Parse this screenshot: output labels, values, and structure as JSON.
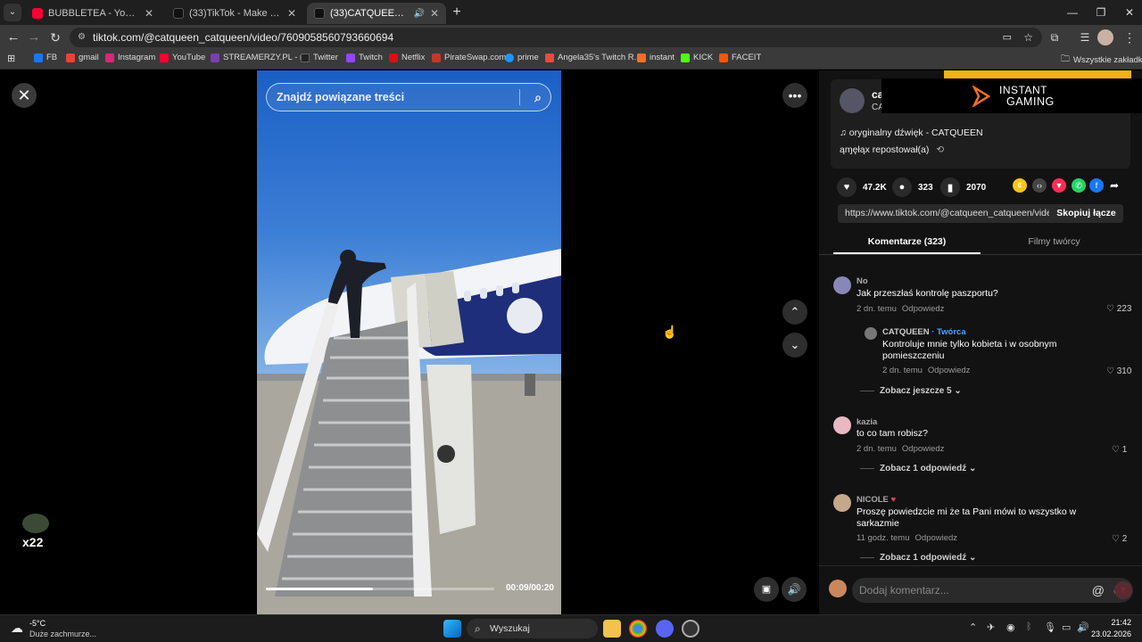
{
  "browser": {
    "tabs": [
      {
        "title": "BUBBLETEA - YouTube",
        "favicon_color": "#ff0033",
        "active": false
      },
      {
        "title": "(33)TikTok - Make Your Day",
        "favicon_color": "#111111",
        "active": false
      },
      {
        "title": "(33)CATQUEEN (@catqueen",
        "favicon_color": "#111111",
        "active": true
      }
    ],
    "url": "tiktok.com/@catqueen_catqueen/video/7609058560793660694",
    "bookmarks": [
      {
        "label": "FB",
        "color": "#1877f2"
      },
      {
        "label": "gmail",
        "color": "#ea4335"
      },
      {
        "label": "Instagram",
        "color": "#d62976"
      },
      {
        "label": "YouTube",
        "color": "#ff0033"
      },
      {
        "label": "STREAMERZY.PL - r...",
        "color": "#7a3fb0"
      },
      {
        "label": "Twitter",
        "color": "#222222"
      },
      {
        "label": "Twitch",
        "color": "#9146ff"
      },
      {
        "label": "Netflix",
        "color": "#e50914"
      },
      {
        "label": "PirateSwap.com",
        "color": "#c0392b"
      },
      {
        "label": "prime",
        "color": "#1a98ff"
      },
      {
        "label": "Angela35's Twitch R...",
        "color": "#e74c3c"
      },
      {
        "label": "instant",
        "color": "#f37021"
      },
      {
        "label": "KICK",
        "color": "#53fc18"
      },
      {
        "label": "FACEIT",
        "color": "#ff5500"
      }
    ],
    "all_bookmarks": "Wszystkie zakładki"
  },
  "video": {
    "search_placeholder": "Znajdź powiązane treści",
    "timer": "00:09/00:20",
    "progress_fraction": 0.47
  },
  "overlay_badge": "x22",
  "panel": {
    "author_short": "ca",
    "author_sub": "CA",
    "ad": {
      "line1": "INSTANT",
      "line2": "GAMING"
    },
    "sound": "oryginalny dźwięk - CATQUEEN",
    "repost": "ąɱęłąx repostował(a)",
    "stats": {
      "likes": "47.2K",
      "comments": "323",
      "saves": "2070"
    },
    "share_colors": [
      "#f5c518",
      "#444444",
      "#fe2c55",
      "#25d366",
      "#1877f2",
      "#121212"
    ],
    "link": "https://www.tiktok.com/@catqueen_catqueen/vide...",
    "copy_label": "Skopiuj łącze",
    "tab_comments": "Komentarze (323)",
    "tab_videos": "Filmy twórcy",
    "comments": [
      {
        "name": "No",
        "text": "Jak przeszłaś kontrolę paszportu?",
        "time": "2 dn. temu",
        "reply": "Odpowiedz",
        "likes": "223"
      },
      {
        "name": "CATQUEEN",
        "badge": "· Twórca",
        "text": "Kontroluje mnie tylko kobieta i w osobnym pomieszczeniu",
        "time": "2 dn. temu",
        "reply": "Odpowiedz",
        "likes": "310"
      },
      {
        "name": "kazia",
        "text": "to co tam robisz?",
        "time": "2 dn. temu",
        "reply": "Odpowiedz",
        "likes": "1"
      },
      {
        "name": "NICOLE",
        "text": "Proszę powiedzcie mi że ta Pani mówi to wszystko w sarkazmie",
        "time": "11 godz. temu",
        "reply": "Odpowiedz",
        "likes": "2"
      }
    ],
    "more1": "Zobacz jeszcze 5",
    "more2": "Zobacz 1 odpowiedź",
    "more3": "Zobacz 1 odpowiedź",
    "comment_placeholder": "Dodaj komentarz..."
  },
  "taskbar": {
    "weather_temp": "-5°C",
    "weather_desc": "Duże zachmurze...",
    "search": "Wyszukaj",
    "time": "21:42",
    "date": "23.02.2026"
  }
}
